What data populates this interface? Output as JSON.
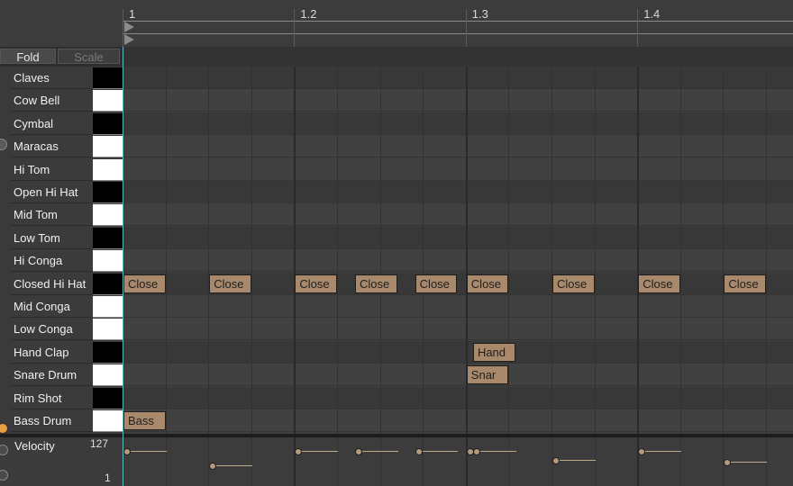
{
  "ruler": {
    "bars": [
      "1",
      "1.2",
      "1.3",
      "1.4"
    ]
  },
  "toolbar": {
    "fold_label": "Fold",
    "scale_label": "Scale"
  },
  "lanes": [
    {
      "name": "Claves",
      "key": "black"
    },
    {
      "name": "Cow Bell",
      "key": "white"
    },
    {
      "name": "Cymbal",
      "key": "black"
    },
    {
      "name": "Maracas",
      "key": "white"
    },
    {
      "name": "Hi Tom",
      "key": "white"
    },
    {
      "name": "Open Hi Hat",
      "key": "black"
    },
    {
      "name": "Mid Tom",
      "key": "white"
    },
    {
      "name": "Low Tom",
      "key": "black"
    },
    {
      "name": "Hi Conga",
      "key": "white"
    },
    {
      "name": "Closed Hi Hat",
      "key": "black"
    },
    {
      "name": "Mid Conga",
      "key": "white"
    },
    {
      "name": "Low Conga",
      "key": "white"
    },
    {
      "name": "Hand Clap",
      "key": "black"
    },
    {
      "name": "Snare Drum",
      "key": "white"
    },
    {
      "name": "Rim Shot",
      "key": "black"
    },
    {
      "name": "Bass Drum",
      "key": "white"
    }
  ],
  "notes": [
    {
      "label": "Close",
      "lane": 9,
      "step": 0
    },
    {
      "label": "Close",
      "lane": 9,
      "step": 2
    },
    {
      "label": "Close",
      "lane": 9,
      "step": 4
    },
    {
      "label": "Close",
      "lane": 9,
      "step": 5.4
    },
    {
      "label": "Close",
      "lane": 9,
      "step": 6.8
    },
    {
      "label": "Close",
      "lane": 9,
      "step": 8
    },
    {
      "label": "Close",
      "lane": 9,
      "step": 10
    },
    {
      "label": "Close",
      "lane": 9,
      "step": 12
    },
    {
      "label": "Close",
      "lane": 9,
      "step": 14
    },
    {
      "label": "Hand",
      "lane": 12,
      "step": 8.15
    },
    {
      "label": "Snar",
      "lane": 13,
      "step": 8
    },
    {
      "label": "Bass",
      "lane": 15,
      "step": 0
    }
  ],
  "velocity": {
    "label": "Velocity",
    "max": "127",
    "min": "1",
    "values": [
      {
        "step": 0,
        "value": 0.9
      },
      {
        "step": 2,
        "value": 0.45
      },
      {
        "step": 4,
        "value": 0.9
      },
      {
        "step": 5.4,
        "value": 0.9
      },
      {
        "step": 6.8,
        "value": 0.9
      },
      {
        "step": 8,
        "value": 0.9
      },
      {
        "step": 8.15,
        "value": 0.9
      },
      {
        "step": 10,
        "value": 0.6
      },
      {
        "step": 12,
        "value": 0.9
      },
      {
        "step": 14,
        "value": 0.55
      }
    ]
  },
  "colors": {
    "note": "#a8896b",
    "playhead": "#5fb8c8",
    "accent_button": "#e8a040"
  },
  "icons": [
    "fold-toggle-icon",
    "velocity-expand-icon",
    "velocity-options-icon",
    "velocity-play-icon"
  ]
}
